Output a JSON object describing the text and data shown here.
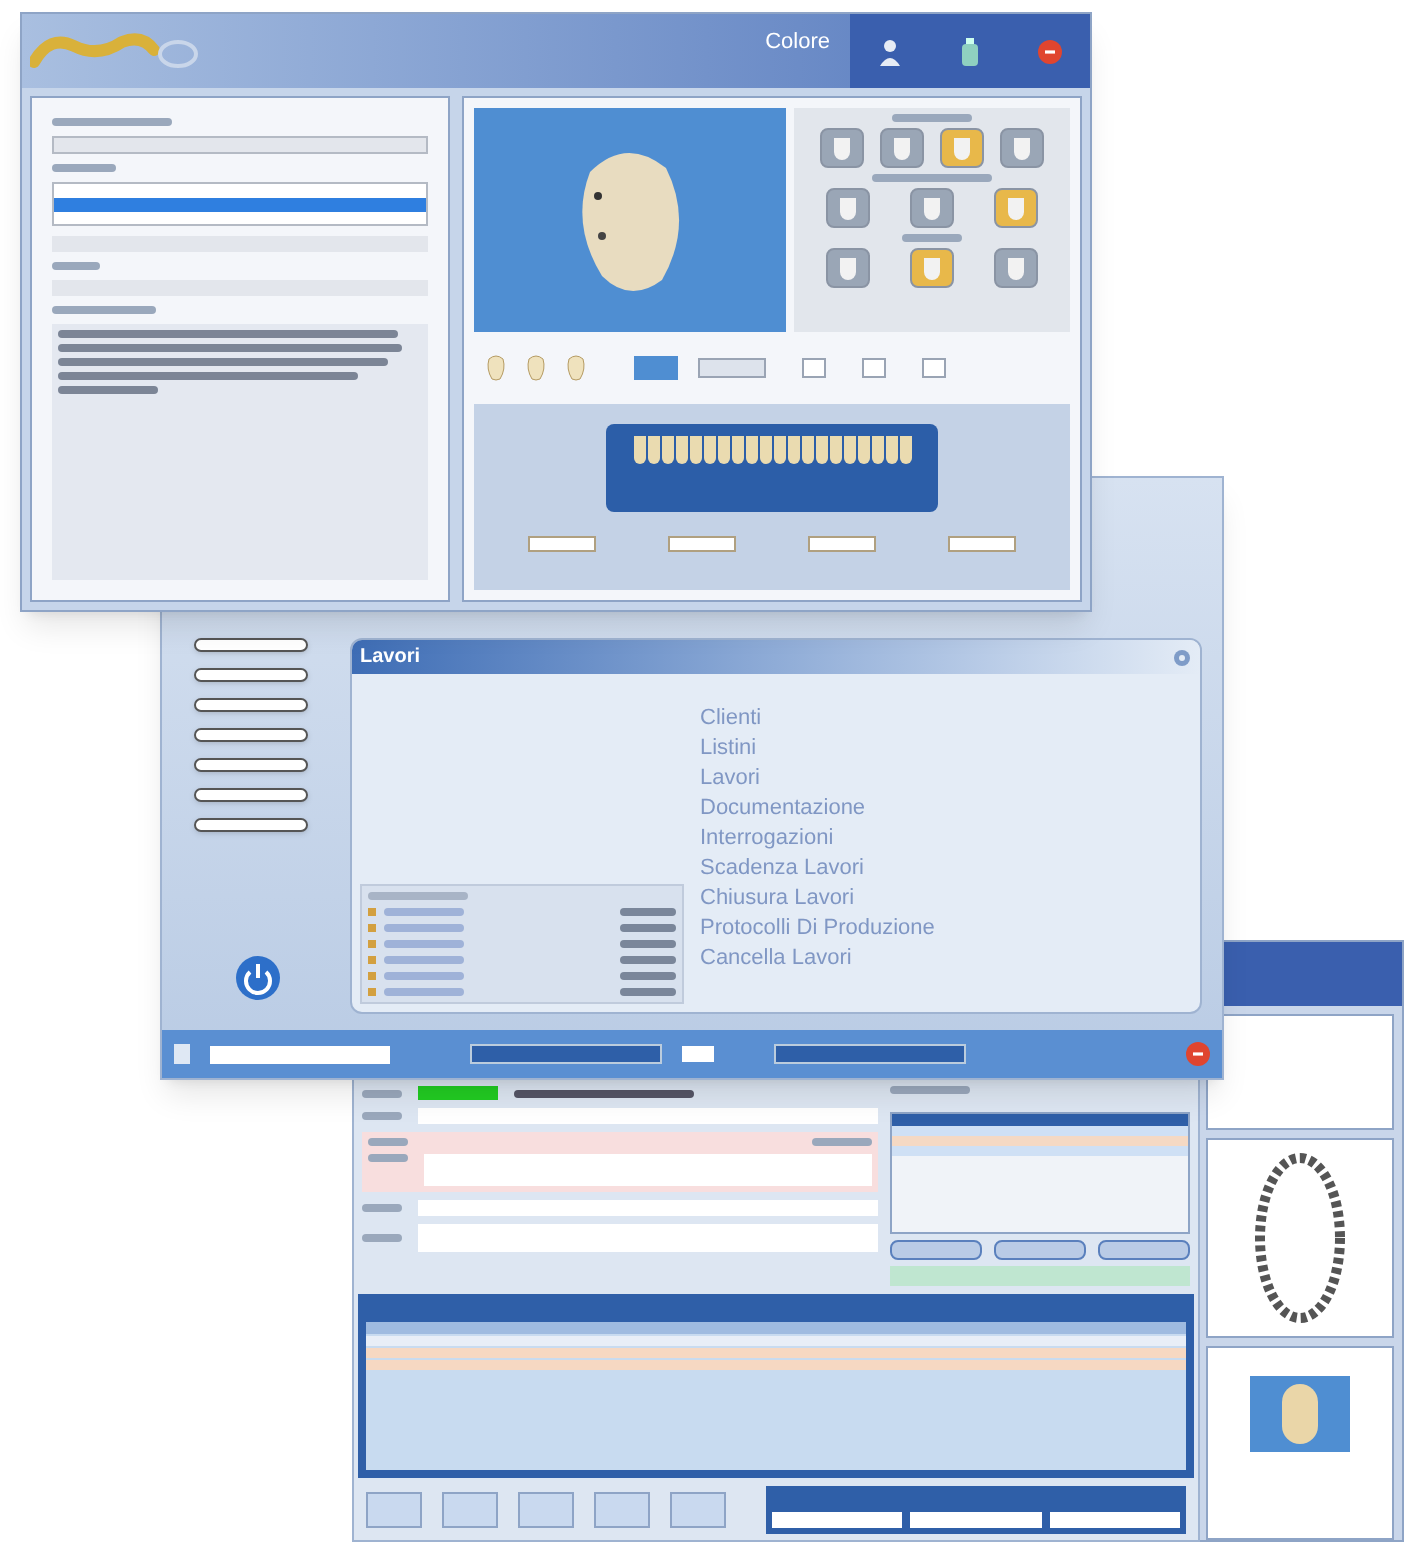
{
  "colore_window": {
    "title": "Colore"
  },
  "lavori_window": {
    "panel_title": "Lavori",
    "menu": [
      {
        "label": "Clienti"
      },
      {
        "label": "Listini"
      },
      {
        "label": "Lavori"
      },
      {
        "label": "Documentazione"
      },
      {
        "label": "Interrogazioni"
      },
      {
        "label": "Scadenza Lavori"
      },
      {
        "label": "Chiusura Lavori"
      },
      {
        "label": "Protocolli Di Produzione"
      },
      {
        "label": "Cancella Lavori"
      }
    ]
  }
}
